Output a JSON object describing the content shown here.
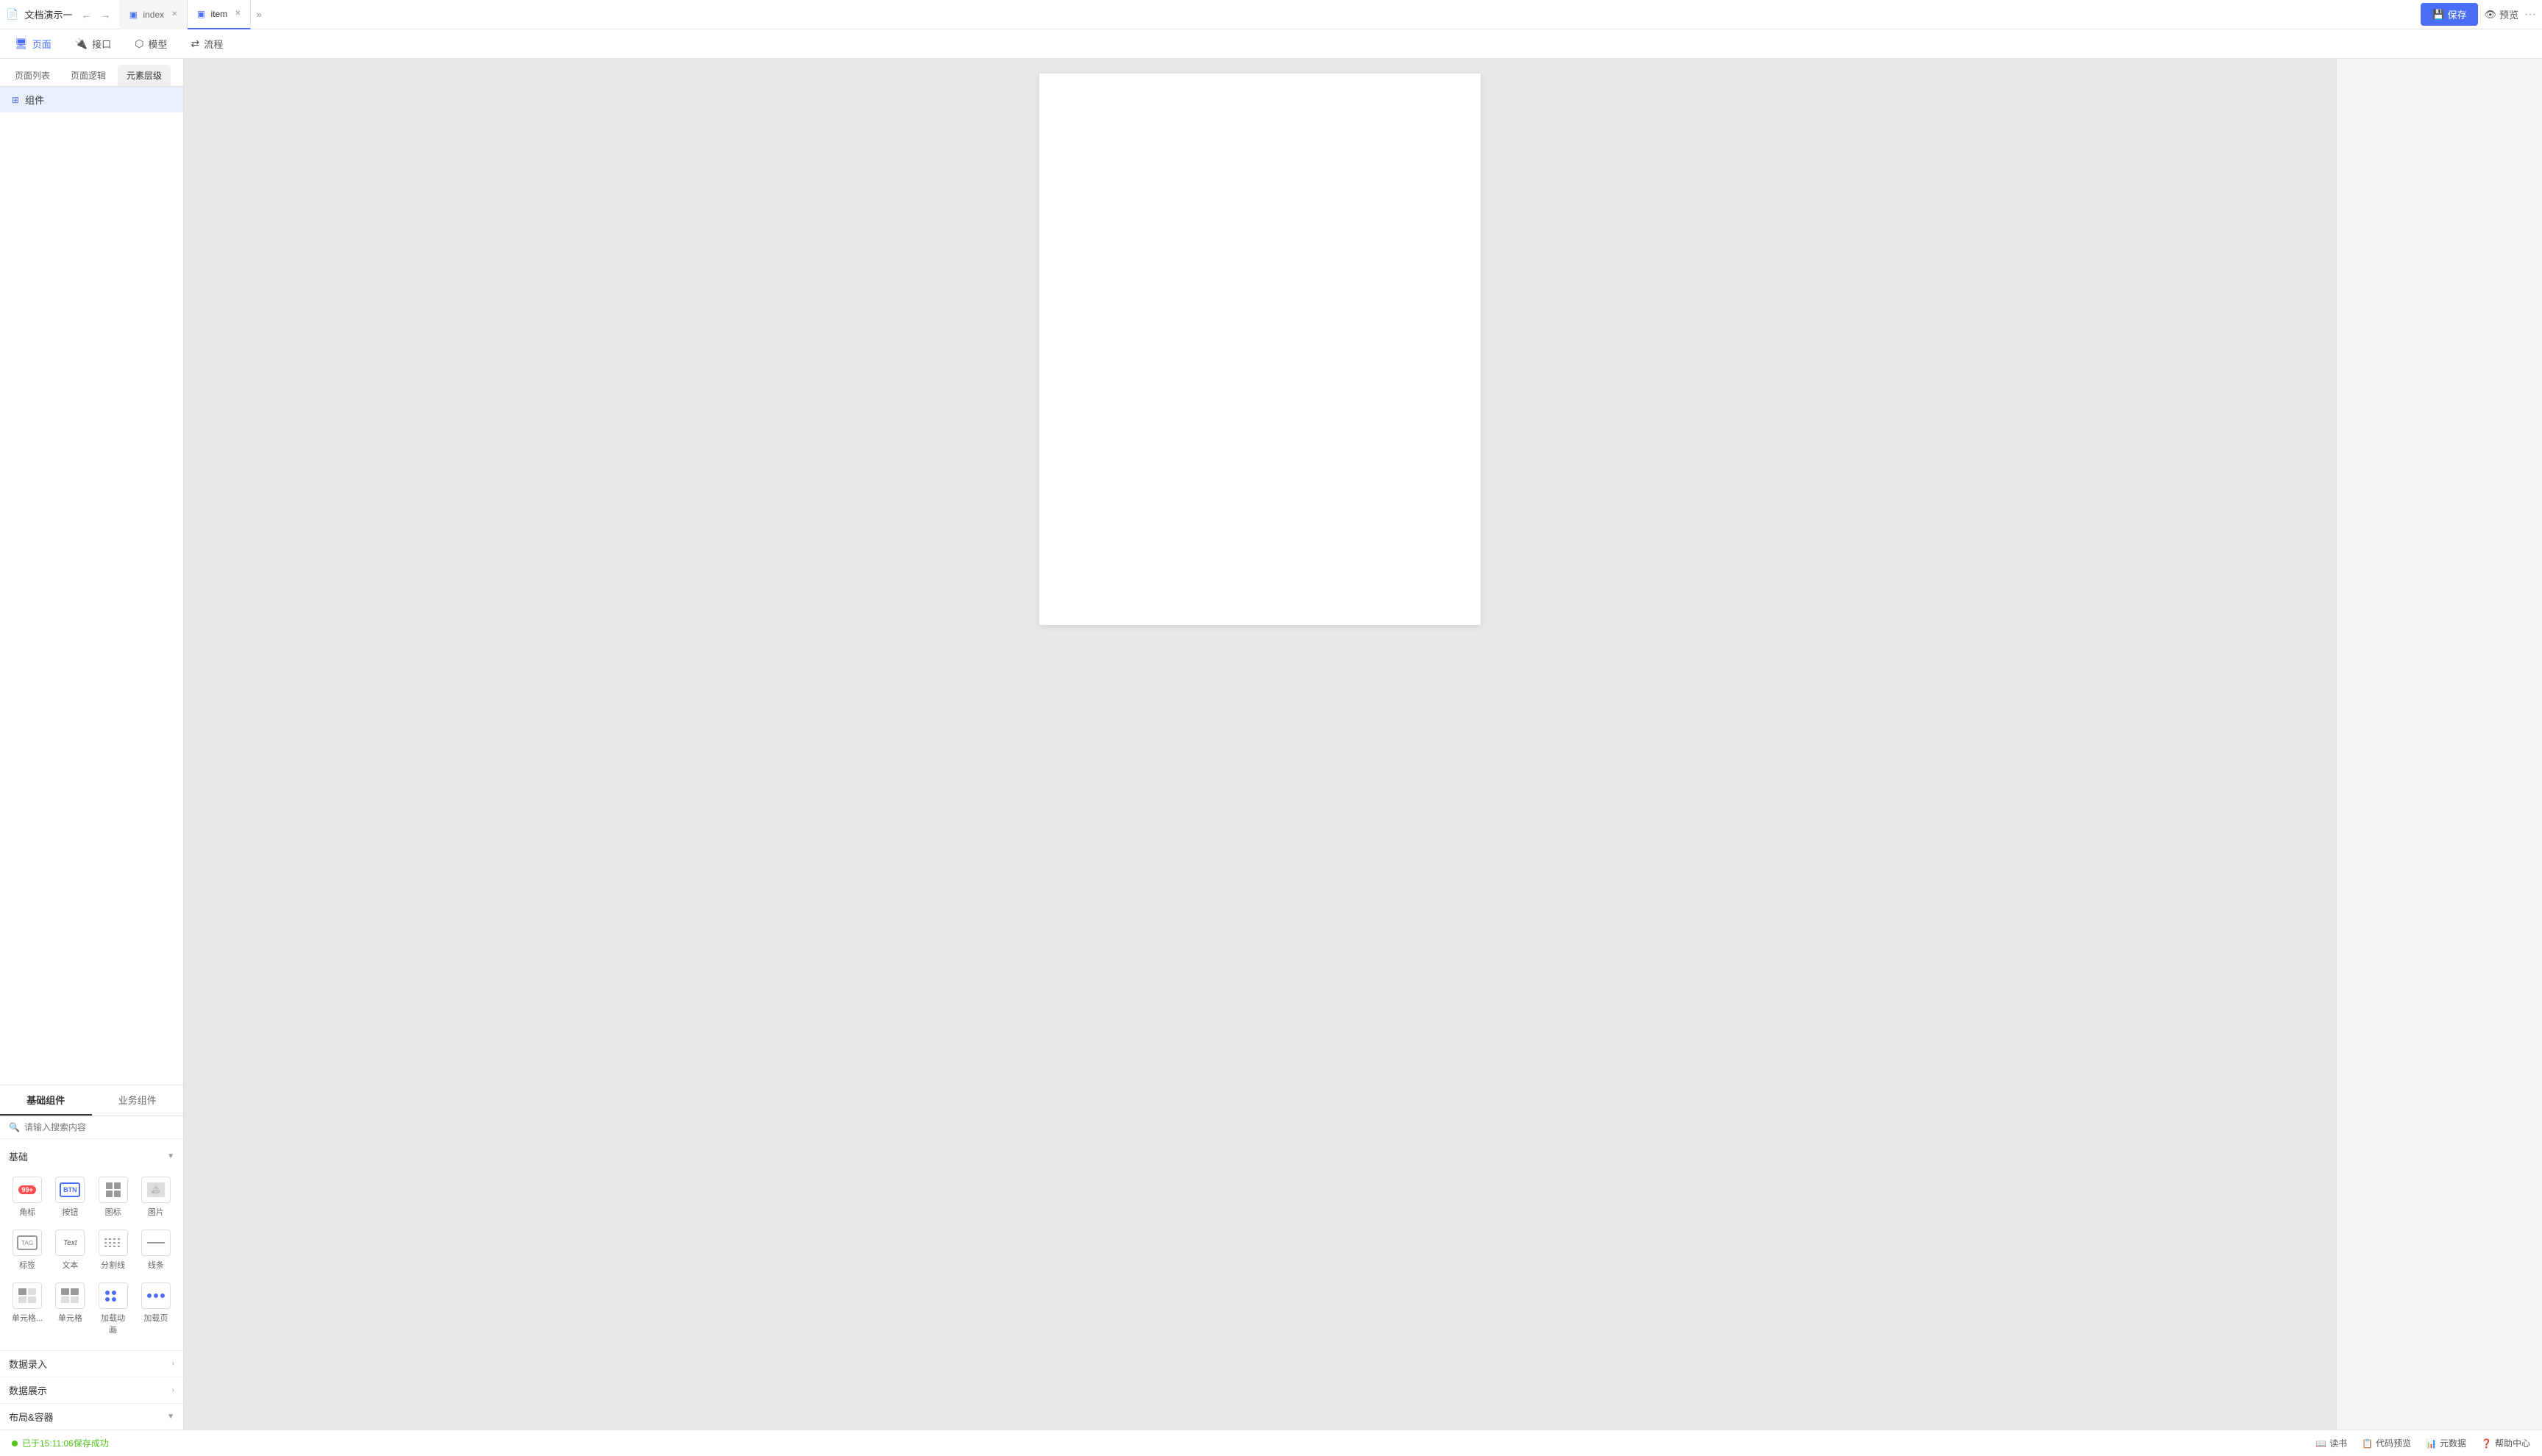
{
  "app": {
    "title": "文档演示一",
    "doc_icon": "📄"
  },
  "tabs": [
    {
      "id": "index",
      "label": "index",
      "active": false,
      "closable": true
    },
    {
      "id": "item",
      "label": "item",
      "active": true,
      "closable": true
    }
  ],
  "toolbar": {
    "save_label": "保存",
    "preview_label": "预览",
    "more_label": "···"
  },
  "nav_items": [
    {
      "id": "page",
      "label": "页面",
      "active": true
    },
    {
      "id": "interface",
      "label": "接口",
      "active": false
    },
    {
      "id": "model",
      "label": "模型",
      "active": false
    },
    {
      "id": "flow",
      "label": "流程",
      "active": false
    }
  ],
  "sidebar": {
    "tabs": [
      {
        "id": "page-list",
        "label": "页面列表",
        "active": false
      },
      {
        "id": "page-logic",
        "label": "页面逻辑",
        "active": false
      },
      {
        "id": "element-layer",
        "label": "元素层级",
        "active": true
      }
    ],
    "layer_items": [
      {
        "icon": "⊞",
        "label": "组件"
      }
    ]
  },
  "components": {
    "tabs": [
      {
        "id": "basic",
        "label": "基础组件",
        "active": true
      },
      {
        "id": "business",
        "label": "业务组件",
        "active": false
      }
    ],
    "search_placeholder": "请输入搜索内容",
    "sections": [
      {
        "id": "basic",
        "title": "基础",
        "collapsed": false,
        "items": [
          {
            "id": "badge",
            "label": "角标",
            "icon_type": "badge"
          },
          {
            "id": "button",
            "label": "按钮",
            "icon_type": "button"
          },
          {
            "id": "icon",
            "label": "图标",
            "icon_type": "icon-grid"
          },
          {
            "id": "image",
            "label": "图片",
            "icon_type": "image"
          },
          {
            "id": "tag",
            "label": "标签",
            "icon_type": "tag"
          },
          {
            "id": "text",
            "label": "文本",
            "icon_type": "text"
          },
          {
            "id": "divider",
            "label": "分割线",
            "icon_type": "divider"
          },
          {
            "id": "line",
            "label": "线条",
            "icon_type": "line"
          },
          {
            "id": "cell-single",
            "label": "单元格...",
            "icon_type": "cell-single"
          },
          {
            "id": "cell",
            "label": "单元格",
            "icon_type": "cell"
          },
          {
            "id": "loading-anim",
            "label": "加载动画",
            "icon_type": "loading-anim"
          },
          {
            "id": "loading-page",
            "label": "加载页",
            "icon_type": "loading-page"
          }
        ]
      },
      {
        "id": "data-entry",
        "title": "数据录入",
        "collapsed": true,
        "items": []
      },
      {
        "id": "data-display",
        "title": "数据展示",
        "collapsed": true,
        "items": []
      },
      {
        "id": "layout-container",
        "title": "布局&容器",
        "collapsed": false,
        "items": []
      }
    ]
  },
  "bottom": {
    "status_text": "已于15:11:06保存成功",
    "actions": [
      {
        "id": "read",
        "label": "读书"
      },
      {
        "id": "code-preview",
        "label": "代码预览"
      },
      {
        "id": "meta-data",
        "label": "元数据"
      },
      {
        "id": "help",
        "label": "帮助中心"
      }
    ]
  }
}
